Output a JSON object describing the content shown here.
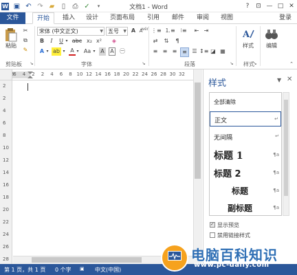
{
  "window": {
    "title": "文档1 - Word",
    "controls": [
      "?",
      "⊡",
      "—",
      "□",
      "✕"
    ]
  },
  "qat": {
    "icons": [
      "word-logo",
      "save",
      "undo",
      "redo",
      "open",
      "new",
      "print",
      "spell",
      "more"
    ]
  },
  "tabs": {
    "file": "文件",
    "items": [
      "开始",
      "插入",
      "设计",
      "页面布局",
      "引用",
      "邮件",
      "审阅",
      "视图"
    ],
    "login": "登录"
  },
  "ribbon": {
    "clipboard": {
      "paste": "粘贴",
      "label": "剪贴板"
    },
    "font": {
      "name": "宋体 (中文正文)",
      "size": "五号",
      "label": "字体",
      "row1_buttons": [
        "A",
        "A",
        "Aa",
        "A"
      ],
      "row2_buttons": [
        "B",
        "I",
        "U",
        "abc",
        "x₂",
        "x²"
      ],
      "row3_buttons": [
        "A",
        "ab",
        "A",
        "Aa",
        "A",
        "A"
      ]
    },
    "paragraph": {
      "label": "段落"
    },
    "styles": {
      "label": "样式"
    },
    "editing": {
      "label": "编辑"
    },
    "phonetic_label": "wén"
  },
  "ruler": {
    "h_ticks": [
      "8",
      "6",
      "4",
      "2",
      "2",
      "4",
      "6",
      "8",
      "10",
      "12",
      "14",
      "16",
      "18",
      "20",
      "22",
      "24",
      "26",
      "28",
      "30",
      "32"
    ],
    "v_ticks": [
      "2",
      "2",
      "4",
      "6",
      "8",
      "10",
      "12",
      "14",
      "16",
      "18",
      "20",
      "22",
      "24",
      "26",
      "28"
    ]
  },
  "styles_pane": {
    "title": "样式",
    "pin": "▼",
    "close": "✕",
    "items": [
      {
        "name": "全部清除",
        "mark": ""
      },
      {
        "name": "正文",
        "mark": "↵"
      },
      {
        "name": "无间隔",
        "mark": "↵"
      },
      {
        "name": "标题 1",
        "mark": "¶a"
      },
      {
        "name": "标题 2",
        "mark": "¶a"
      },
      {
        "name": "标题",
        "mark": "¶a"
      },
      {
        "name": "副标题",
        "mark": "¶a"
      }
    ],
    "show_preview": "显示预览",
    "disable_linked": "禁用链接样式"
  },
  "status": {
    "page": "第 1 页，共 1 页",
    "words": "0 个字",
    "lang": "中文(中国)"
  },
  "watermark": {
    "brand": "电脑百科知识",
    "url": "www.pc-daily.com"
  }
}
